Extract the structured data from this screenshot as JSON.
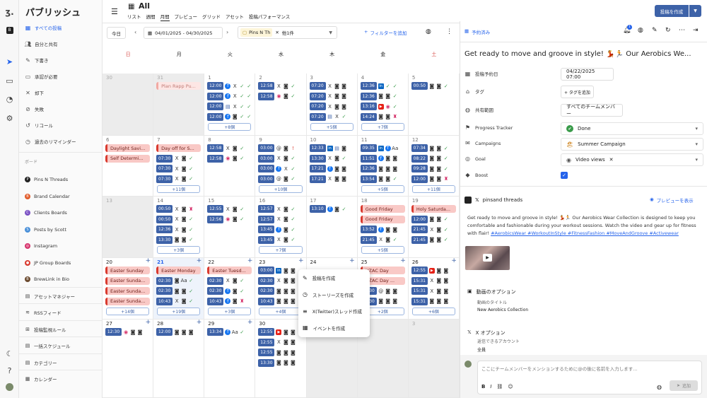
{
  "sidebar": {
    "title": "パブリッシュ",
    "nav": [
      "すべての投稿",
      "自分と共有",
      "下書き",
      "承認が必要",
      "却下",
      "失敗",
      "リコール",
      "過去のリマインダー"
    ],
    "section_label": "ボード",
    "boards": [
      "Pins N Threads",
      "Brand Calendar",
      "Clients Boards",
      "Posts by Scott",
      "Instagram",
      "JP Group Boards",
      "BrewLink in Bio",
      "アセットマネジャー",
      "RSSフィード",
      "投稿監視ルール",
      "一括スケジュール",
      "カテゴリー",
      "カレンダー"
    ]
  },
  "header": {
    "title": "All",
    "tabs": [
      "リスト",
      "週間",
      "月間",
      "プレビュー",
      "グリッド",
      "アセット",
      "投稿パフォーマンス"
    ],
    "active_tab": "月間",
    "create_button": "投稿を作成"
  },
  "toolbar": {
    "today": "今日",
    "date_range": "04/01/2025 - 04/30/2025",
    "filter_chip": "Pins N Th",
    "filter_more": "他1件",
    "add_filter": "フィルターを追加"
  },
  "calendar": {
    "weekdays": [
      "日",
      "月",
      "火",
      "水",
      "木",
      "金",
      "土"
    ],
    "weeks": [
      {
        "days": [
          {
            "n": "30",
            "gray": true,
            "items": []
          },
          {
            "n": "31",
            "gray": true,
            "items": [
              {
                "ev": "Plan Rapp Pu...",
                "faded": true
              }
            ]
          },
          {
            "n": "1",
            "items": [
              {
                "t": "12:00",
                "ic": "f X ✓ ✓"
              },
              {
                "t": "12:00",
                "ic": "f X ✓ ✓"
              },
              {
                "t": "12:00",
                "ic": "▤ X ✓ ✓"
              },
              {
                "t": "12:00",
                "ic": "f ◙ ✓ ✓"
              }
            ],
            "more": "+8個"
          },
          {
            "n": "2",
            "items": [
              {
                "t": "12:58",
                "ic": "X ◙ ✓"
              },
              {
                "t": "12:58",
                "ic": "◉ ◙ ✓"
              }
            ]
          },
          {
            "n": "3",
            "items": [
              {
                "t": "07:20",
                "ic": "X ◙ ◙"
              },
              {
                "t": "07:20",
                "ic": "X ◙ ◙"
              },
              {
                "t": "07:20",
                "ic": "X ◙ ◙"
              },
              {
                "t": "07:20",
                "ic": "▤ X ✓"
              }
            ],
            "more": "+5個"
          },
          {
            "n": "4",
            "items": [
              {
                "t": "12:36",
                "ic": "in ✓ ✓"
              },
              {
                "t": "12:36",
                "ic": "◙ ◙ ✓"
              },
              {
                "t": "13:16",
                "ic": "▶ ◉ ✓"
              },
              {
                "t": "14:24",
                "ic": "◙ ◙ ♜"
              }
            ],
            "more": "+7個"
          },
          {
            "n": "5",
            "items": [
              {
                "t": "00:50",
                "ic": "◙ ◙ ✓"
              }
            ]
          }
        ]
      },
      {
        "days": [
          {
            "n": "6",
            "items": [
              {
                "ev": "Daylight Savi..."
              },
              {
                "ev": "Self Determi..."
              }
            ]
          },
          {
            "n": "7",
            "items": [
              {
                "ev": "Day off for S..."
              },
              {
                "t": "07:30",
                "ic": "X ◙ ✓"
              },
              {
                "t": "07:30",
                "ic": "X ◙ ✓"
              },
              {
                "t": "07:30",
                "ic": "X ◙ ✓"
              }
            ],
            "more": "+11個"
          },
          {
            "n": "8",
            "items": [
              {
                "t": "12:58",
                "ic": "X ◙ ✓"
              },
              {
                "t": "12:58",
                "ic": "◉ ◙ ✓"
              }
            ]
          },
          {
            "n": "9",
            "items": [
              {
                "t": "03:00",
                "ic": "@ ◙ !"
              },
              {
                "t": "03:00",
                "ic": "X ◙ ✓"
              },
              {
                "t": "03:00",
                "ic": "f X ✓"
              },
              {
                "t": "03:00",
                "ic": "@ ◙ ✓"
              }
            ],
            "more": "+10個"
          },
          {
            "n": "10",
            "items": [
              {
                "t": "12:33",
                "ic": "in ▤ ◙"
              },
              {
                "t": "13:30",
                "ic": "X ◙ ✓"
              },
              {
                "t": "17:21",
                "ic": "f ◙ ◙"
              },
              {
                "t": "17:21",
                "ic": "X ◙ ◙"
              }
            ]
          },
          {
            "n": "11",
            "items": [
              {
                "t": "09:35",
                "ic": "in f Aa"
              },
              {
                "t": "11:51",
                "ic": "f ◙ ◙"
              },
              {
                "t": "12:36",
                "ic": "◙ ◙ ◙"
              },
              {
                "t": "13:54",
                "ic": "◙ ◙ ✓"
              }
            ],
            "more": "+5個"
          },
          {
            "n": "12",
            "items": [
              {
                "t": "07:34",
                "ic": "◙ ◙ ✓"
              },
              {
                "t": "08:22",
                "ic": "◙ ◙ ✓"
              },
              {
                "t": "09:28",
                "ic": "◙ ◙ ✓"
              },
              {
                "t": "12:00",
                "ic": "◙ ◙ ♜"
              }
            ],
            "more": "+11個"
          }
        ]
      },
      {
        "days": [
          {
            "n": "13",
            "gray": true,
            "items": []
          },
          {
            "n": "14",
            "items": [
              {
                "t": "00:50",
                "ic": "X ◙ ♜"
              },
              {
                "t": "00:50",
                "ic": "X ◙ ✓"
              },
              {
                "t": "12:36",
                "ic": "X ◙ ✓"
              },
              {
                "t": "13:30",
                "ic": "◙ ◙ ✓"
              }
            ],
            "more": "+3個"
          },
          {
            "n": "15",
            "items": [
              {
                "t": "12:55",
                "ic": "X ◙ ✓"
              },
              {
                "t": "12:56",
                "ic": "◉ ◙ ✓"
              }
            ]
          },
          {
            "n": "16",
            "items": [
              {
                "t": "12:57",
                "ic": "X ◙ ✓"
              },
              {
                "t": "12:57",
                "ic": "X ◙ ✓"
              },
              {
                "t": "13:45",
                "ic": "f ◙ ✓"
              },
              {
                "t": "13:45",
                "ic": "X ◙ ✓"
              }
            ],
            "more": "+7個"
          },
          {
            "n": "17",
            "items": [
              {
                "t": "13:10",
                "ic": "f ◙ ✓"
              }
            ]
          },
          {
            "n": "18",
            "items": [
              {
                "ev": "Good Friday"
              },
              {
                "ev": "Good Friday"
              },
              {
                "t": "13:52",
                "ic": "f ◙ ◙"
              },
              {
                "t": "21:45",
                "ic": "X ◙ ✓"
              }
            ],
            "more": "+5個"
          },
          {
            "n": "19",
            "items": [
              {
                "ev": "Holy Saturda..."
              },
              {
                "t": "12:00",
                "ic": "◙ ◙ ✓"
              },
              {
                "t": "21:45",
                "ic": "X ◙ ✓"
              },
              {
                "t": "21:45",
                "ic": "◙ ◙ ✓"
              }
            ]
          }
        ]
      },
      {
        "days": [
          {
            "n": "20",
            "items": [
              {
                "ev": "Easter Sunday"
              },
              {
                "ev": "Easter Sunda..."
              },
              {
                "ev": "Easter Sunda..."
              },
              {
                "ev": "Easter Sunda..."
              }
            ],
            "more": "+14個"
          },
          {
            "n": "21",
            "hl": true,
            "items": [
              {
                "ev": "Easter Monday"
              },
              {
                "t": "02:30",
                "ic": "◙ Aa ✓"
              },
              {
                "t": "02:30",
                "ic": "◙ ◙ ✓"
              },
              {
                "t": "10:43",
                "ic": "X ◙ ✓"
              }
            ],
            "more": "+19個"
          },
          {
            "n": "22",
            "items": [
              {
                "ev": "Easter Tuesd..."
              },
              {
                "t": "02:30",
                "ic": "X ◙ ✓"
              },
              {
                "t": "02:30",
                "ic": "f ◙ ✓"
              },
              {
                "t": "10:43",
                "ic": "f ◙ ♜"
              }
            ],
            "more": "+3個"
          },
          {
            "n": "23",
            "items": [
              {
                "t": "03:00",
                "ic": "in ◙ ◙"
              },
              {
                "t": "02:30",
                "ic": "X ◙ ◙"
              },
              {
                "t": "02:30",
                "ic": "◙ ◙ ◙"
              },
              {
                "t": "10:43",
                "ic": "◙ ◙ ◙"
              }
            ],
            "more": "+4個"
          },
          {
            "n": "24",
            "items": []
          },
          {
            "n": "25",
            "items": [
              {
                "ev": "NZAC Day"
              },
              {
                "ev": "NZAC Day ..."
              },
              {
                "t": "01:30",
                "ic": "@ ◙ ◙"
              },
              {
                "t": "01:30",
                "ic": "◙ ◙ ◙"
              }
            ],
            "more": "+2個"
          },
          {
            "n": "26",
            "items": [
              {
                "t": "12:55",
                "ic": "▶ ◙ ◙"
              },
              {
                "t": "15:31",
                "ic": "X ◙ ◙"
              },
              {
                "t": "15:31",
                "ic": "X ◙ ◙"
              },
              {
                "t": "15:31",
                "ic": "◙ ◙ ◙"
              }
            ],
            "more": "+6個"
          }
        ]
      },
      {
        "days": [
          {
            "n": "27",
            "items": [
              {
                "t": "12:30",
                "ic": "◉ ◙ ◙"
              }
            ]
          },
          {
            "n": "28",
            "items": [
              {
                "t": "12:00",
                "ic": "◙ ◙ ◙"
              }
            ]
          },
          {
            "n": "29",
            "items": [
              {
                "t": "13:34",
                "ic": "f Aa ✓"
              }
            ]
          },
          {
            "n": "30",
            "items": [
              {
                "t": "12:55",
                "ic": "▶ ◙ ◙"
              },
              {
                "t": "12:55",
                "ic": "X ◙ ◙"
              },
              {
                "t": "12:55",
                "ic": "◙ ◙ ◙"
              },
              {
                "t": "13:30",
                "ic": "◙ ◙ ◙"
              }
            ]
          },
          {
            "n": "1",
            "gray": true,
            "items": []
          },
          {
            "n": "2",
            "gray": true,
            "items": []
          },
          {
            "n": "3",
            "gray": true,
            "items": []
          }
        ]
      }
    ]
  },
  "context_menu": [
    "投稿を作成",
    "ストーリーズを作成",
    "X(Twitter)スレッド作成",
    "イベントを作成"
  ],
  "panel": {
    "status": "予約済み",
    "notif_count": "1",
    "title": "Get ready to move and groove in style! 💃🏃 Our Aerobics We...",
    "fields": [
      {
        "label": "投稿予約日",
        "value": "04/22/2025 07:00"
      },
      {
        "label": "タグ",
        "value": "+ タグを追加"
      },
      {
        "label": "共有範囲",
        "value": "すべてのチームメンバー"
      },
      {
        "label": "Progress Tracker",
        "value": "Done"
      },
      {
        "label": "Campaigns",
        "value": "Summer Campaign"
      },
      {
        "label": "Goal",
        "value": "Video views"
      },
      {
        "label": "Boost",
        "value": ""
      }
    ],
    "account": "pinsand threads",
    "preview_link": "プレビューを表示",
    "body": "Get ready to move and groove in style! 💃🏃 Our Aerobics Wear Collection is designed to keep you comfortable and fashionable during your workout sessions. Watch the video and gear up for fitness with flair! ",
    "hashtags": "#AerobicsWear #WorkoutInStyle #FitnessFashion #MoveAndGroove #Activewear",
    "video_options_title": "動画のオプション",
    "video_title_label": "動画のタイトル",
    "video_title_value": "New Aerobics Collection",
    "x_options_title": "X オプション",
    "reply_label": "返信できるアカウント",
    "reply_value": "全員",
    "comment_placeholder": "ここにチームメンバーをメンションするために@の後に名前を入力します...",
    "send_button": "追加"
  }
}
